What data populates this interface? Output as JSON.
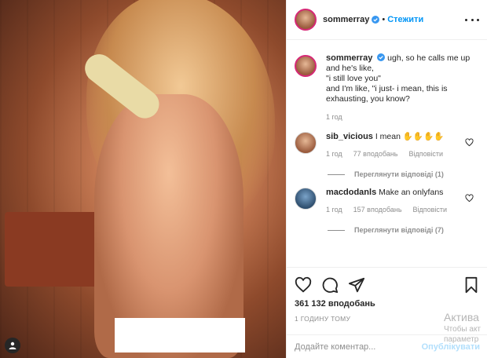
{
  "post": {
    "username": "sommerray",
    "follow_label": "Стежити",
    "dot": "•"
  },
  "caption": {
    "username": "sommerray",
    "text": "ugh, so he calls me up and he's like,\n\"i still love you\"\nand I'm like, \"i just- i mean, this is exhausting, you know?",
    "time": "1 год"
  },
  "comments": [
    {
      "username": "sib_vicious",
      "text": "I mean ✋✋✋✋",
      "time": "1 год",
      "likes": "77 вподобань",
      "reply_label": "Відповісти",
      "view_replies": "Переглянути відповіді (1)"
    },
    {
      "username": "macdodanls",
      "text": "Make an onlyfans",
      "time": "1 год",
      "likes": "157 вподобань",
      "reply_label": "Відповісти",
      "view_replies": "Переглянути відповіді (7)"
    }
  ],
  "actions": {
    "likes_count": "361 132 вподобань",
    "post_time": "1 ГОДИНУ ТОМУ"
  },
  "add_comment": {
    "placeholder": "Додайте коментар...",
    "publish_label": "Опублікувати"
  },
  "watermark": {
    "line1": "Актива",
    "line2": "Чтобы акт",
    "line3": "параметр"
  },
  "icons": {
    "verified": "verified-badge-icon",
    "more": "more-options-icon",
    "heart": "heart-icon",
    "comment": "comment-icon",
    "share": "share-icon",
    "save": "bookmark-icon",
    "account": "account-tag-icon"
  },
  "colors": {
    "accent": "#0095f6",
    "muted": "#8e8e8e",
    "text": "#262626",
    "border": "#efefef"
  }
}
